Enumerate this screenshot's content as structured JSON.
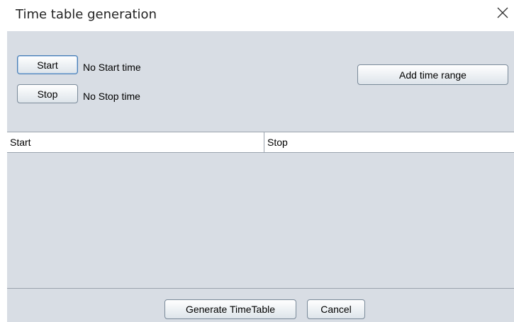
{
  "window": {
    "title": "Time table generation"
  },
  "start": {
    "button_label": "Start",
    "status_text": "No Start time"
  },
  "stop": {
    "button_label": "Stop",
    "status_text": "No Stop time"
  },
  "add_range": {
    "button_label": "Add time range"
  },
  "table": {
    "columns": [
      "Start",
      "Stop"
    ],
    "rows": []
  },
  "footer": {
    "generate_label": "Generate TimeTable",
    "cancel_label": "Cancel"
  },
  "icons": {
    "close": "close-icon"
  },
  "colors": {
    "panel_background": "#d8dde4",
    "focus_border": "#4a7fb5"
  }
}
